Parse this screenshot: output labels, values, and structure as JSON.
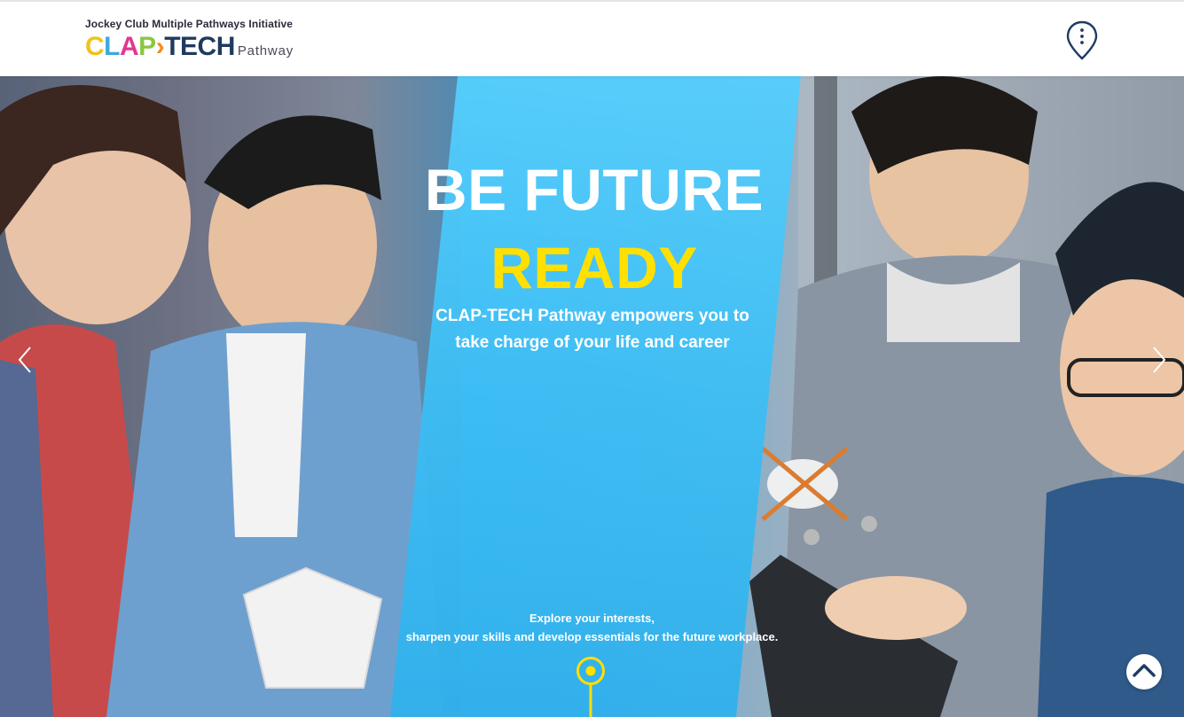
{
  "header": {
    "tagline": "Jockey Club Multiple Pathways Initiative",
    "logo": {
      "letters": [
        {
          "char": "C",
          "color": "#f2c21b"
        },
        {
          "char": "L",
          "color": "#3aa8e0"
        },
        {
          "char": "A",
          "color": "#e2388f"
        },
        {
          "char": "P",
          "color": "#8cc63f"
        },
        {
          "char": "›",
          "color": "#f28c1b"
        },
        {
          "char": "T",
          "color": "#1e3a5f"
        },
        {
          "char": "E",
          "color": "#1e3a5f"
        },
        {
          "char": "C",
          "color": "#1e3a5f"
        },
        {
          "char": "H",
          "color": "#1e3a5f"
        }
      ],
      "sub": "Pathway"
    },
    "location_icon": "map-pin-dots-icon"
  },
  "hero": {
    "title": "BE FUTURE",
    "title_highlight": "READY",
    "subtitle_line1": "CLAP-TECH Pathway empowers you to",
    "subtitle_line2": "take charge of your life and career",
    "explore_line1": "Explore your interests,",
    "explore_line2": "sharpen your skills and develop essentials for the future workplace.",
    "colors": {
      "panel": "#4ecbfb",
      "highlight": "#ffe000",
      "text": "#ffffff"
    }
  },
  "controls": {
    "prev_icon": "chevron-left-icon",
    "next_icon": "chevron-right-icon",
    "top_icon": "chevron-up-icon",
    "scroll_icon": "scroll-indicator-icon"
  }
}
